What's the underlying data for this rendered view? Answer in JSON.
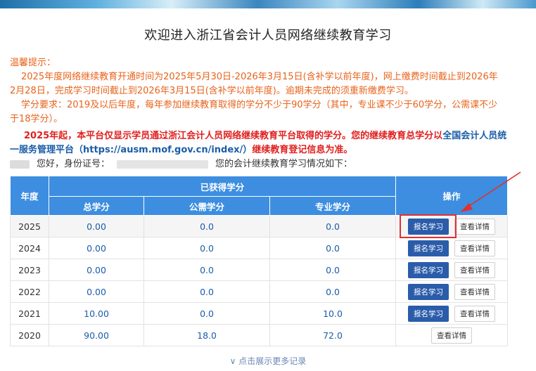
{
  "page_title": "欢迎进入浙江省会计人员网络继续教育学习",
  "notice": {
    "heading": "温馨提示：",
    "line1": "2025年度网络继续教育开通时间为2025年5月30日-2026年3月15日(含补学以前年度)，网上缴费时间截止到2026年2月28日，完成学习时间截止到2026年3月15日(含补学以前年度)。逾期未完成的须重新缴费学习。",
    "line2": "学分要求：2019及以后年度，每年参加继续教育取得的学分不少于90学分（其中，专业课不少于60学分，公需课不少于18学分）。"
  },
  "credit_statement": {
    "part1": "2025年起，本平台仅显示学员通过浙江会计人员网络继续教育平台取得的学分。您的继续教育总学分以",
    "link": "全国会计人员统一服务管理平台（https://ausm.mof.gov.cn/index/）",
    "part2": "继续教育登记信息为准。"
  },
  "greeting": {
    "hello": "您好，身份证号：",
    "suffix": "您的会计继续教育学习情况如下："
  },
  "table": {
    "headers": {
      "year": "年度",
      "group": "已获得学分",
      "total": "总学分",
      "public": "公需学分",
      "professional": "专业学分",
      "actions": "操作"
    },
    "rows": [
      {
        "year": "2025",
        "total": "0.00",
        "public": "0.0",
        "professional": "0.0"
      },
      {
        "year": "2024",
        "total": "0.00",
        "public": "0.0",
        "professional": "0.0"
      },
      {
        "year": "2023",
        "total": "0.00",
        "public": "0.0",
        "professional": "0.0"
      },
      {
        "year": "2022",
        "total": "0.00",
        "public": "0.0",
        "professional": "0.0"
      },
      {
        "year": "2021",
        "total": "10.00",
        "public": "0.0",
        "professional": "10.0"
      },
      {
        "year": "2020",
        "total": "90.00",
        "public": "18.0",
        "professional": "72.0"
      }
    ],
    "enroll_label": "报名学习",
    "detail_label": "查看详情"
  },
  "show_more": "点击展示更多记录",
  "colors": {
    "header_blue": "#3d8ee0",
    "notice_orange": "#e8631b",
    "statement_red": "#e02020",
    "link_blue": "#1a5ca8",
    "button_blue": "#2a5caa",
    "callout_red": "#e03030"
  }
}
